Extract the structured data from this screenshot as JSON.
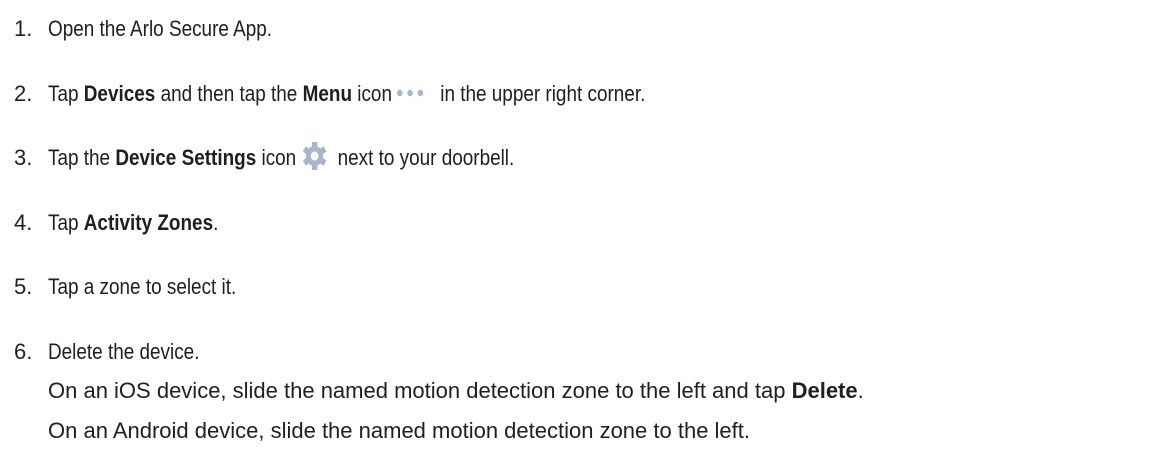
{
  "steps": [
    {
      "num": "1.",
      "text": "Open the Arlo Secure App."
    },
    {
      "num": "2.",
      "pre": "Tap ",
      "bold1": "Devices",
      "mid": " and then tap the ",
      "bold2": "Menu",
      "post1": " icon",
      "post2": " in the  upper right corner."
    },
    {
      "num": "3.",
      "pre": "Tap the ",
      "bold": "Device Settings",
      "post1": " icon",
      "post2": " next to your doorbell."
    },
    {
      "num": "4.",
      "pre": "Tap ",
      "bold": "Activity Zones",
      "post": "."
    },
    {
      "num": "5.",
      "text": "Tap a zone to select it."
    },
    {
      "num": "6.",
      "text": "Delete the device."
    }
  ],
  "ios_line": {
    "text": "On an iOS device, slide the named motion detection zone to the left and tap ",
    "bold": "Delete",
    "end": "."
  },
  "android_line": {
    "text": "On an Android device, slide the named motion detection zone to the left."
  },
  "icons": {
    "menu": "ellipsis-icon",
    "settings": "gear-icon",
    "icon_color": "#a9b5cc"
  }
}
